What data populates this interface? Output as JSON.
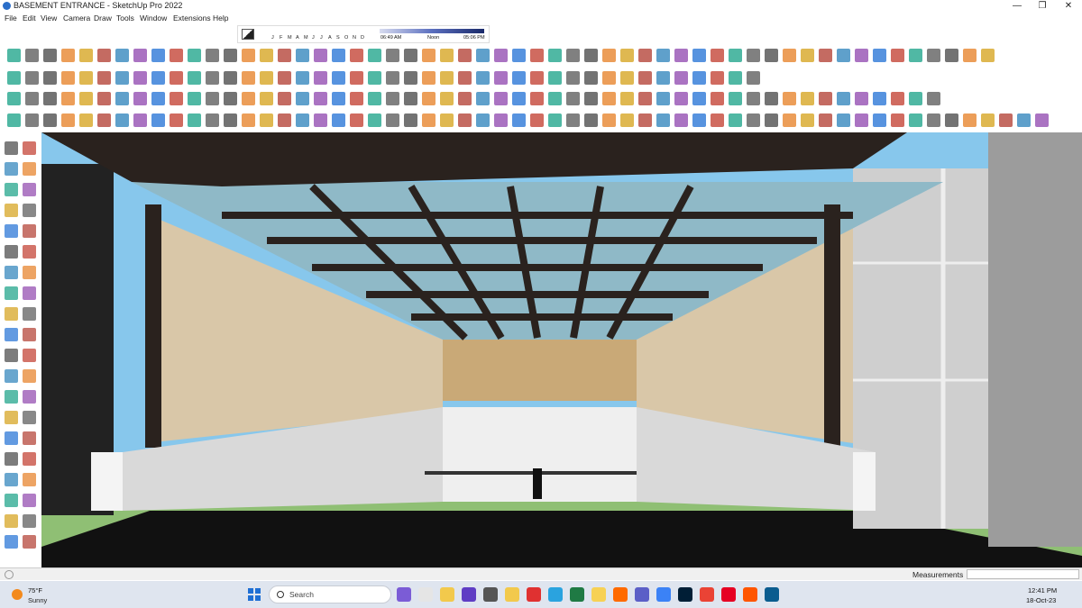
{
  "window": {
    "title": "BASEMENT ENTRANCE - SketchUp Pro 2022",
    "minimize": "—",
    "maximize": "❐",
    "close": "✕"
  },
  "menu": [
    "File",
    "Edit",
    "View",
    "Camera",
    "Draw",
    "Tools",
    "Window",
    "Extensions",
    "Help"
  ],
  "shadows": {
    "months": [
      "J",
      "F",
      "M",
      "A",
      "M",
      "J",
      "J",
      "A",
      "S",
      "O",
      "N",
      "D"
    ],
    "time_start": "06:49 AM",
    "time_noon": "Noon",
    "time_end": "05:06 PM"
  },
  "status": {
    "measurements_label": "Measurements",
    "measurements_value": ""
  },
  "taskbar": {
    "weather_temp": "75°F",
    "weather_condition": "Sunny",
    "search_placeholder": "Search",
    "clock_time": "12:41 PM",
    "clock_date": "18-Oct-23",
    "apps": [
      "widgets",
      "copilot",
      "file-explorer",
      "meet",
      "calculator",
      "files",
      "opera",
      "telegram",
      "excel",
      "sticky-notes",
      "brave",
      "teams",
      "notepad",
      "photoshop",
      "chrome",
      "pinterest",
      "soundcloud",
      "sketchup"
    ]
  },
  "colors": {
    "sky": "#87c7ec",
    "frame": "#2a221e",
    "glass": "#8fb9c7",
    "wall": "#d9d9d9",
    "grass": "#8fbf74",
    "accent": "#f38a1d"
  }
}
